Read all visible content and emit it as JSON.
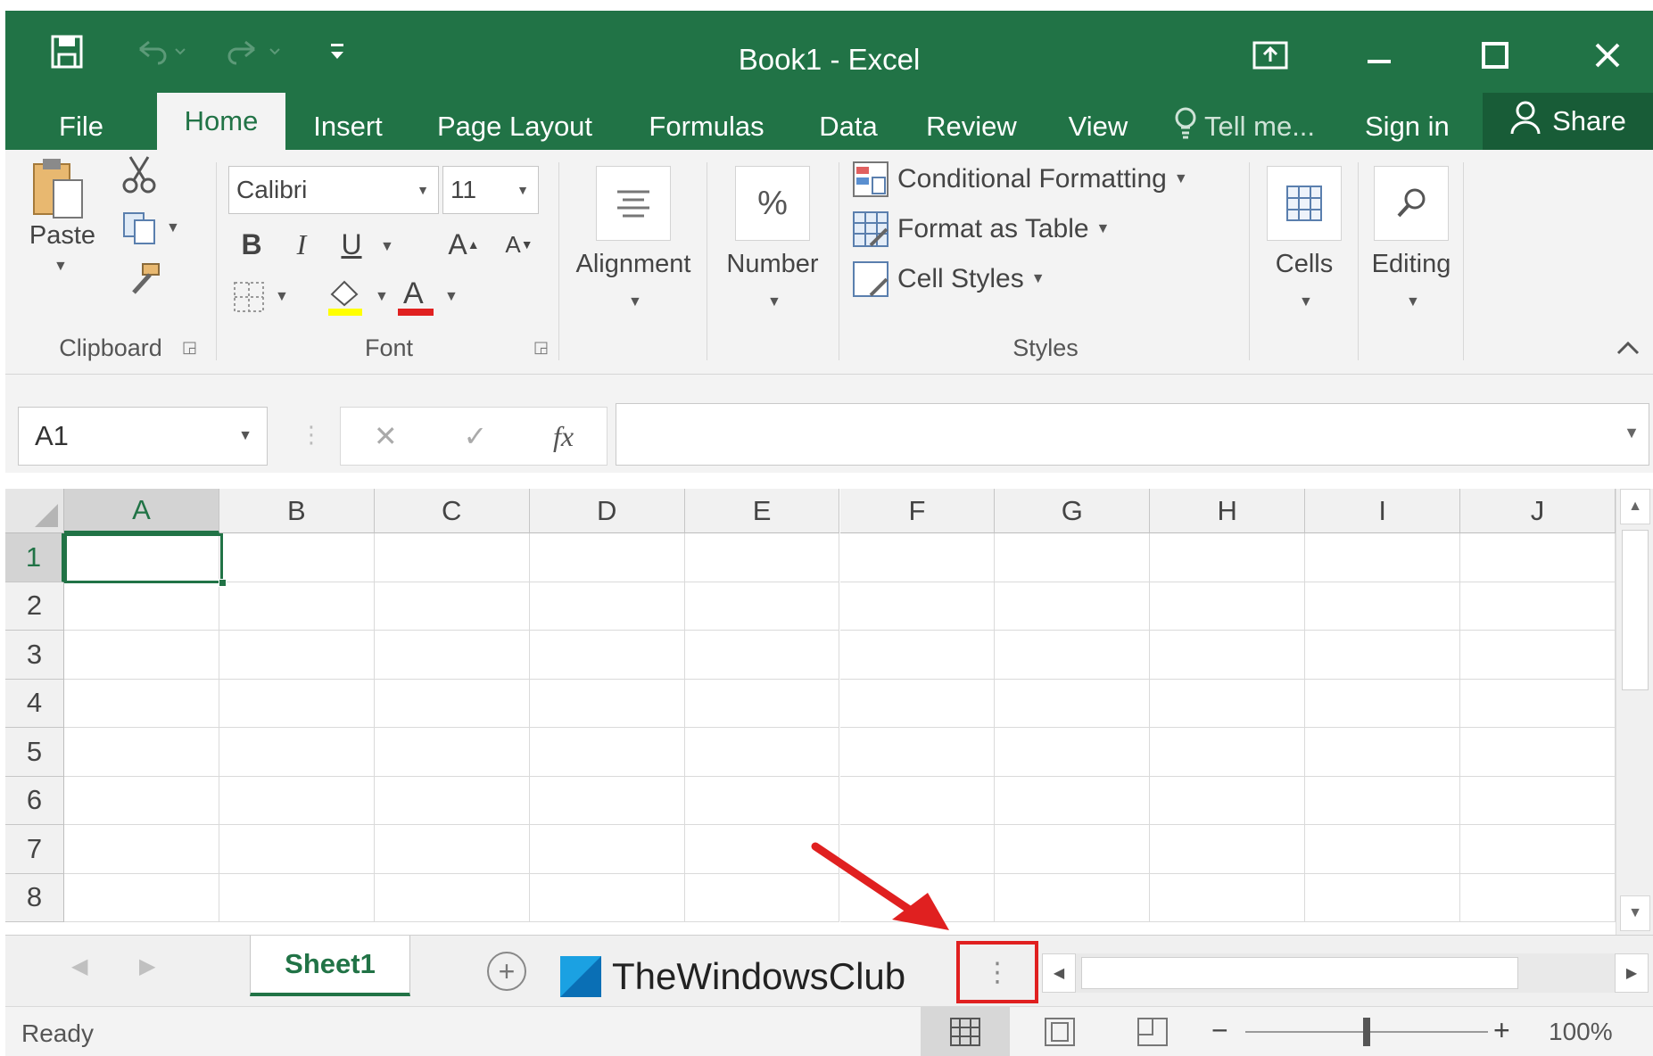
{
  "window": {
    "title": "Book1 - Excel"
  },
  "tabs": [
    {
      "label": "File"
    },
    {
      "label": "Home",
      "active": true
    },
    {
      "label": "Insert"
    },
    {
      "label": "Page Layout"
    },
    {
      "label": "Formulas"
    },
    {
      "label": "Data"
    },
    {
      "label": "Review"
    },
    {
      "label": "View"
    }
  ],
  "tell_me": "Tell me...",
  "sign_in": "Sign in",
  "share": "Share",
  "ribbon": {
    "clipboard": {
      "paste": "Paste",
      "label": "Clipboard"
    },
    "font": {
      "name": "Calibri",
      "size": "11",
      "bold": "B",
      "italic": "I",
      "underline": "U",
      "grow": "A",
      "shrink": "A",
      "font_color": "A",
      "label": "Font"
    },
    "alignment": {
      "label": "Alignment"
    },
    "number": {
      "symbol": "%",
      "label": "Number"
    },
    "styles": {
      "conditional_formatting": "Conditional Formatting",
      "format_as_table": "Format as Table",
      "cell_styles": "Cell Styles",
      "label": "Styles"
    },
    "cells": {
      "label": "Cells"
    },
    "editing": {
      "label": "Editing"
    }
  },
  "formula_bar": {
    "name_box": "A1",
    "cancel": "✕",
    "enter": "✓",
    "fx": "fx",
    "value": ""
  },
  "grid": {
    "columns": [
      "A",
      "B",
      "C",
      "D",
      "E",
      "F",
      "G",
      "H",
      "I",
      "J"
    ],
    "rows": [
      "1",
      "2",
      "3",
      "4",
      "5",
      "6",
      "7",
      "8"
    ],
    "selected_cell": "A1"
  },
  "sheets": [
    {
      "name": "Sheet1",
      "active": true
    }
  ],
  "watermark": "TheWindowsClub",
  "status": {
    "text": "Ready",
    "zoom": "100%",
    "zoom_fraction": 0.5
  },
  "colors": {
    "accent": "#217346",
    "annotation": "#e02020"
  }
}
